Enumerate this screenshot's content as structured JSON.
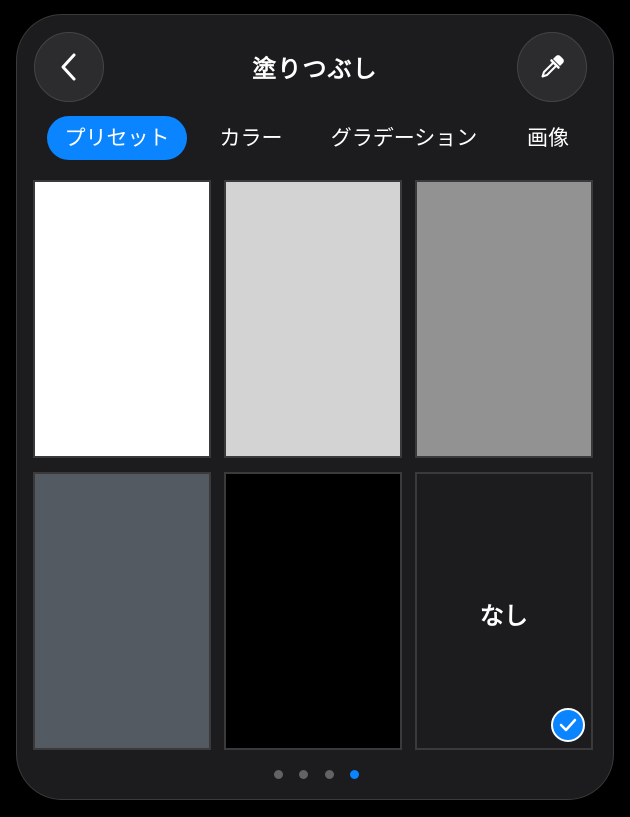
{
  "header": {
    "title": "塗りつぶし",
    "back_icon": "chevron-left-icon",
    "eyedropper_icon": "eyedropper-icon"
  },
  "tabs": [
    {
      "label": "プリセット",
      "selected": true
    },
    {
      "label": "カラー",
      "selected": false
    },
    {
      "label": "グラデーション",
      "selected": false
    },
    {
      "label": "画像",
      "selected": false
    }
  ],
  "swatches": [
    {
      "color": "#ffffff"
    },
    {
      "color": "#d3d3d3"
    },
    {
      "color": "#929292"
    },
    {
      "color": "#545a61"
    },
    {
      "color": "#000000"
    },
    {
      "color": "#1c1c1e",
      "label": "なし",
      "selected": true
    }
  ],
  "pagination": {
    "count": 4,
    "active_index": 3
  },
  "colors": {
    "accent": "#0a84ff",
    "panel": "#1c1c1e"
  }
}
